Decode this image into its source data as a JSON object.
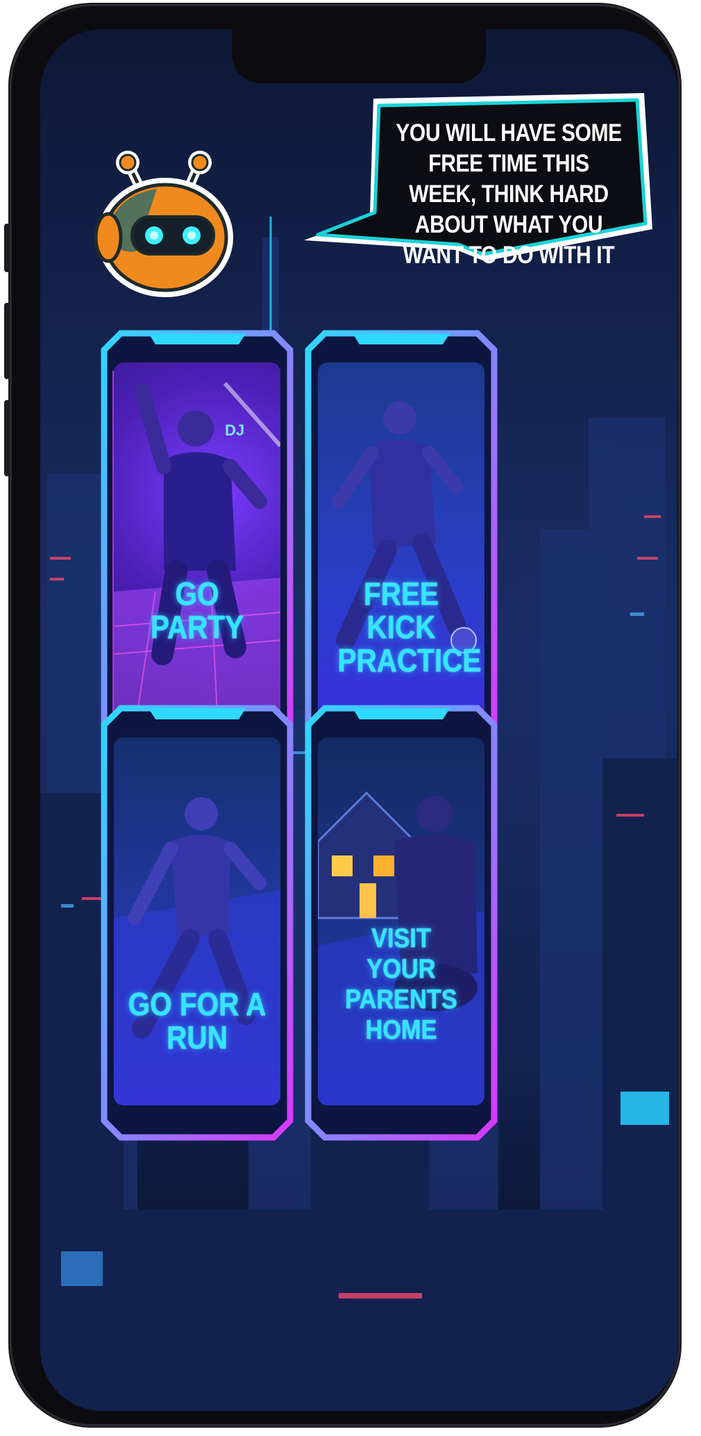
{
  "assistant": {
    "avatar_icon": "robot-mascot-icon",
    "message": "YOU WILL HAVE SOME FREE TIME THIS WEEK, THINK HARD ABOUT WHAT YOU WANT TO DO WITH IT"
  },
  "choices": [
    {
      "label": "GO PARTY",
      "icon": "dancing-party-illustration",
      "sign": "DJ"
    },
    {
      "label": "FREE KICK PRACTICE",
      "icon": "soccer-player-illustration"
    },
    {
      "label": "GO FOR A RUN",
      "icon": "runner-illustration"
    },
    {
      "label": "VISIT YOUR PARENTS HOME",
      "icon": "house-visit-illustration"
    }
  ],
  "colors": {
    "frame_cyan": "#2fd8ff",
    "frame_magenta": "#d938ff",
    "label_cyan": "#34e6ff",
    "bubble_outline": "#19d3d8",
    "robot_orange": "#f08a1e"
  }
}
